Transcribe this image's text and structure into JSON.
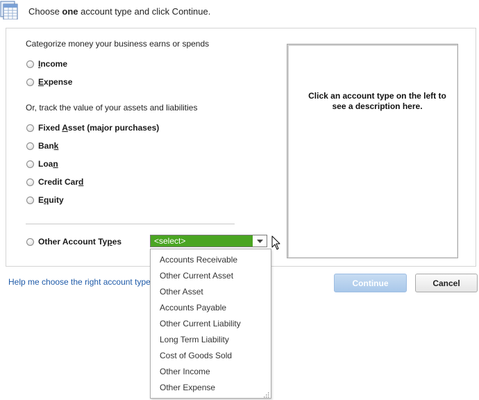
{
  "header": {
    "icon": "account-grid-icon",
    "text_before": "Choose ",
    "text_bold": "one",
    "text_after": " account type and click Continue."
  },
  "categorize_label": "Categorize money your business earns or spends",
  "track_label": "Or, track the value of your assets and liabilities",
  "account_types": {
    "income": {
      "pre": "",
      "ul": "I",
      "post": "ncome"
    },
    "expense": {
      "pre": "",
      "ul": "E",
      "post": "xpense"
    },
    "fixed_asset": {
      "pre": "Fixed ",
      "ul": "A",
      "post": "sset (major purchases)"
    },
    "bank": {
      "pre": "Ban",
      "ul": "k",
      "post": ""
    },
    "loan": {
      "pre": "Loa",
      "ul": "n",
      "post": ""
    },
    "credit_card": {
      "pre": "Credit Car",
      "ul": "d",
      "post": ""
    },
    "equity": {
      "pre": "E",
      "ul": "q",
      "post": "uity"
    },
    "other": {
      "pre": "Other Account Ty",
      "ul": "p",
      "post": "es"
    }
  },
  "other_select": {
    "selected": "<select>",
    "options": [
      "Accounts Receivable",
      "Other Current Asset",
      "Other Asset",
      "Accounts Payable",
      "Other Current Liability",
      "Long Term Liability",
      "Cost of Goods Sold",
      "Other Income",
      "Other Expense"
    ]
  },
  "description_text": "Click an account type on the left to see a description here.",
  "help_link": "Help me choose the right account type",
  "buttons": {
    "continue": "Continue",
    "cancel": "Cancel"
  },
  "colors": {
    "select_highlight": "#4aa522",
    "link": "#1e5aa8",
    "continue_disabled": "#a9c8ea"
  }
}
